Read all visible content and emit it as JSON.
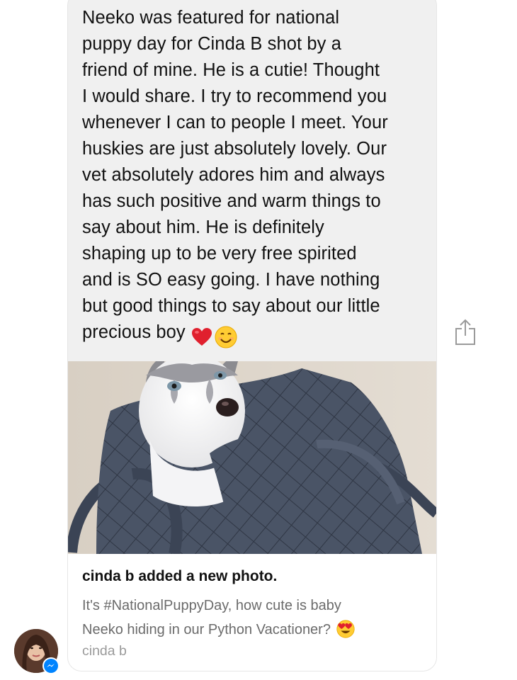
{
  "message": {
    "text": "Neeko was featured for national\npuppy day for Cinda B shot by a\nfriend of mine. He is a cutie! Thought\nI would share. I try to recommend you\nwhenever I can to people I meet. Your\nhuskies are just absolutely lovely. Our\nvet absolutely adores him and always\nhas such positive and warm things to\nsay about him. He is definitely\nshaping up to be very free spirited\nand is SO easy going. I have nothing\nbut good things to say about our little\nprecious boy",
    "emojis": [
      "red-heart",
      "smiling-face"
    ]
  },
  "shared_post": {
    "title": "cinda b added a new photo.",
    "description": "It's #NationalPuppyDay, how cute is baby\nNeeko hiding in our Python Vacationer?",
    "description_emoji": "heart-eyes",
    "source": "cinda b"
  },
  "colors": {
    "bubble": "#f0f0f0",
    "messenger_blue": "#0084ff",
    "heart_red": "#e0202e",
    "emoji_yellow": "#ffcc33"
  }
}
